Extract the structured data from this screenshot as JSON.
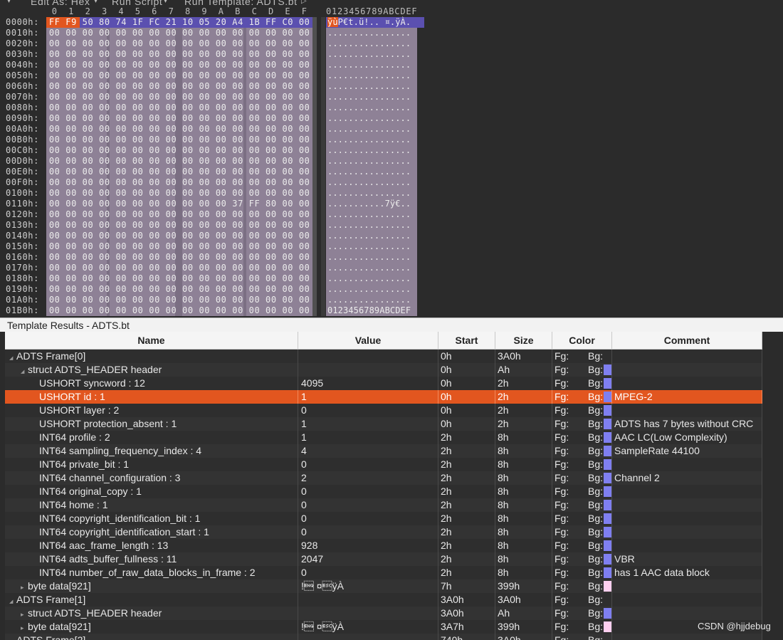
{
  "toolbar": {
    "edit_as": "Edit As: Hex",
    "run_script": "Run Script",
    "run_template": "Run Template: ADTS.bt"
  },
  "hex": {
    "col_headers": [
      "0",
      "1",
      "2",
      "3",
      "4",
      "5",
      "6",
      "7",
      "8",
      "9",
      "A",
      "B",
      "C",
      "D",
      "E",
      "F"
    ],
    "ascii_header": "0123456789ABCDEF",
    "rows": [
      {
        "addr": "0000h:",
        "bytes": [
          "FF",
          "F9",
          "50",
          "80",
          "74",
          "1F",
          "FC",
          "21",
          "10",
          "05",
          "20",
          "A4",
          "1B",
          "FF",
          "C0",
          "00"
        ],
        "ascii": "ÿùP€t.ü!.. ¤.ÿÀ."
      },
      {
        "addr": "0010h:",
        "bytes": [
          "00",
          "00",
          "00",
          "00",
          "00",
          "00",
          "00",
          "00",
          "00",
          "00",
          "00",
          "00",
          "00",
          "00",
          "00",
          "00"
        ],
        "ascii": "................"
      },
      {
        "addr": "0020h:",
        "bytes": [
          "00",
          "00",
          "00",
          "00",
          "00",
          "00",
          "00",
          "00",
          "00",
          "00",
          "00",
          "00",
          "00",
          "00",
          "00",
          "00"
        ],
        "ascii": "................"
      },
      {
        "addr": "0030h:",
        "bytes": [
          "00",
          "00",
          "00",
          "00",
          "00",
          "00",
          "00",
          "00",
          "00",
          "00",
          "00",
          "00",
          "00",
          "00",
          "00",
          "00"
        ],
        "ascii": "................"
      },
      {
        "addr": "0040h:",
        "bytes": [
          "00",
          "00",
          "00",
          "00",
          "00",
          "00",
          "00",
          "00",
          "00",
          "00",
          "00",
          "00",
          "00",
          "00",
          "00",
          "00"
        ],
        "ascii": "................"
      },
      {
        "addr": "0050h:",
        "bytes": [
          "00",
          "00",
          "00",
          "00",
          "00",
          "00",
          "00",
          "00",
          "00",
          "00",
          "00",
          "00",
          "00",
          "00",
          "00",
          "00"
        ],
        "ascii": "................"
      },
      {
        "addr": "0060h:",
        "bytes": [
          "00",
          "00",
          "00",
          "00",
          "00",
          "00",
          "00",
          "00",
          "00",
          "00",
          "00",
          "00",
          "00",
          "00",
          "00",
          "00"
        ],
        "ascii": "................"
      },
      {
        "addr": "0070h:",
        "bytes": [
          "00",
          "00",
          "00",
          "00",
          "00",
          "00",
          "00",
          "00",
          "00",
          "00",
          "00",
          "00",
          "00",
          "00",
          "00",
          "00"
        ],
        "ascii": "................"
      },
      {
        "addr": "0080h:",
        "bytes": [
          "00",
          "00",
          "00",
          "00",
          "00",
          "00",
          "00",
          "00",
          "00",
          "00",
          "00",
          "00",
          "00",
          "00",
          "00",
          "00"
        ],
        "ascii": "................"
      },
      {
        "addr": "0090h:",
        "bytes": [
          "00",
          "00",
          "00",
          "00",
          "00",
          "00",
          "00",
          "00",
          "00",
          "00",
          "00",
          "00",
          "00",
          "00",
          "00",
          "00"
        ],
        "ascii": "................"
      },
      {
        "addr": "00A0h:",
        "bytes": [
          "00",
          "00",
          "00",
          "00",
          "00",
          "00",
          "00",
          "00",
          "00",
          "00",
          "00",
          "00",
          "00",
          "00",
          "00",
          "00"
        ],
        "ascii": "................"
      },
      {
        "addr": "00B0h:",
        "bytes": [
          "00",
          "00",
          "00",
          "00",
          "00",
          "00",
          "00",
          "00",
          "00",
          "00",
          "00",
          "00",
          "00",
          "00",
          "00",
          "00"
        ],
        "ascii": "................"
      },
      {
        "addr": "00C0h:",
        "bytes": [
          "00",
          "00",
          "00",
          "00",
          "00",
          "00",
          "00",
          "00",
          "00",
          "00",
          "00",
          "00",
          "00",
          "00",
          "00",
          "00"
        ],
        "ascii": "................"
      },
      {
        "addr": "00D0h:",
        "bytes": [
          "00",
          "00",
          "00",
          "00",
          "00",
          "00",
          "00",
          "00",
          "00",
          "00",
          "00",
          "00",
          "00",
          "00",
          "00",
          "00"
        ],
        "ascii": "................"
      },
      {
        "addr": "00E0h:",
        "bytes": [
          "00",
          "00",
          "00",
          "00",
          "00",
          "00",
          "00",
          "00",
          "00",
          "00",
          "00",
          "00",
          "00",
          "00",
          "00",
          "00"
        ],
        "ascii": "................"
      },
      {
        "addr": "00F0h:",
        "bytes": [
          "00",
          "00",
          "00",
          "00",
          "00",
          "00",
          "00",
          "00",
          "00",
          "00",
          "00",
          "00",
          "00",
          "00",
          "00",
          "00"
        ],
        "ascii": "................"
      },
      {
        "addr": "0100h:",
        "bytes": [
          "00",
          "00",
          "00",
          "00",
          "00",
          "00",
          "00",
          "00",
          "00",
          "00",
          "00",
          "00",
          "00",
          "00",
          "00",
          "00"
        ],
        "ascii": "................"
      },
      {
        "addr": "0110h:",
        "bytes": [
          "00",
          "00",
          "00",
          "00",
          "00",
          "00",
          "00",
          "00",
          "00",
          "00",
          "00",
          "37",
          "FF",
          "80",
          "00",
          "00"
        ],
        "ascii": "...........7ÿ€.."
      },
      {
        "addr": "0120h:",
        "bytes": [
          "00",
          "00",
          "00",
          "00",
          "00",
          "00",
          "00",
          "00",
          "00",
          "00",
          "00",
          "00",
          "00",
          "00",
          "00",
          "00"
        ],
        "ascii": "................"
      },
      {
        "addr": "0130h:",
        "bytes": [
          "00",
          "00",
          "00",
          "00",
          "00",
          "00",
          "00",
          "00",
          "00",
          "00",
          "00",
          "00",
          "00",
          "00",
          "00",
          "00"
        ],
        "ascii": "................"
      },
      {
        "addr": "0140h:",
        "bytes": [
          "00",
          "00",
          "00",
          "00",
          "00",
          "00",
          "00",
          "00",
          "00",
          "00",
          "00",
          "00",
          "00",
          "00",
          "00",
          "00"
        ],
        "ascii": "................"
      },
      {
        "addr": "0150h:",
        "bytes": [
          "00",
          "00",
          "00",
          "00",
          "00",
          "00",
          "00",
          "00",
          "00",
          "00",
          "00",
          "00",
          "00",
          "00",
          "00",
          "00"
        ],
        "ascii": "................"
      },
      {
        "addr": "0160h:",
        "bytes": [
          "00",
          "00",
          "00",
          "00",
          "00",
          "00",
          "00",
          "00",
          "00",
          "00",
          "00",
          "00",
          "00",
          "00",
          "00",
          "00"
        ],
        "ascii": "................"
      },
      {
        "addr": "0170h:",
        "bytes": [
          "00",
          "00",
          "00",
          "00",
          "00",
          "00",
          "00",
          "00",
          "00",
          "00",
          "00",
          "00",
          "00",
          "00",
          "00",
          "00"
        ],
        "ascii": "................"
      },
      {
        "addr": "0180h:",
        "bytes": [
          "00",
          "00",
          "00",
          "00",
          "00",
          "00",
          "00",
          "00",
          "00",
          "00",
          "00",
          "00",
          "00",
          "00",
          "00",
          "00"
        ],
        "ascii": "................"
      },
      {
        "addr": "0190h:",
        "bytes": [
          "00",
          "00",
          "00",
          "00",
          "00",
          "00",
          "00",
          "00",
          "00",
          "00",
          "00",
          "00",
          "00",
          "00",
          "00",
          "00"
        ],
        "ascii": "................"
      },
      {
        "addr": "01A0h:",
        "bytes": [
          "00",
          "00",
          "00",
          "00",
          "00",
          "00",
          "00",
          "00",
          "00",
          "00",
          "00",
          "00",
          "00",
          "00",
          "00",
          "00"
        ],
        "ascii": "................"
      },
      {
        "addr": "01B0h:",
        "bytes": [
          "00",
          "00",
          "00",
          "00",
          "00",
          "00",
          "00",
          "00",
          "00",
          "00",
          "00",
          "00",
          "00",
          "00",
          "00",
          "00"
        ],
        "ascii": "0123456789ABCDEF"
      }
    ],
    "selected_bytes": 2
  },
  "template": {
    "title": "Template Results - ADTS.bt",
    "headers": [
      "Name",
      "Value",
      "Start",
      "Size",
      "Color",
      "Comment"
    ],
    "fg_label": "Fg:",
    "bg_label": "Bg:",
    "rows": [
      {
        "level": 0,
        "expand": "open",
        "name": "ADTS Frame[0]",
        "value": "",
        "start": "0h",
        "size": "3A0h",
        "swatch": "",
        "comment": ""
      },
      {
        "level": 1,
        "expand": "open",
        "name": "struct ADTS_HEADER header",
        "value": "",
        "start": "0h",
        "size": "Ah",
        "swatch": "#7f7ff0",
        "comment": ""
      },
      {
        "level": 2,
        "expand": "",
        "name": "USHORT syncword : 12",
        "value": "4095",
        "start": "0h",
        "size": "2h",
        "swatch": "#7f7ff0",
        "comment": ""
      },
      {
        "level": 2,
        "expand": "",
        "name": "USHORT id : 1",
        "value": "1",
        "start": "0h",
        "size": "2h",
        "swatch": "#7f7ff0",
        "comment": "MPEG-2",
        "selected": true
      },
      {
        "level": 2,
        "expand": "",
        "name": "USHORT layer : 2",
        "value": "0",
        "start": "0h",
        "size": "2h",
        "swatch": "#7f7ff0",
        "comment": ""
      },
      {
        "level": 2,
        "expand": "",
        "name": "USHORT protection_absent : 1",
        "value": "1",
        "start": "0h",
        "size": "2h",
        "swatch": "#7f7ff0",
        "comment": "ADTS has 7 bytes without CRC"
      },
      {
        "level": 2,
        "expand": "",
        "name": "INT64 profile : 2",
        "value": "1",
        "start": "2h",
        "size": "8h",
        "swatch": "#7f7ff0",
        "comment": "AAC LC(Low Complexity)"
      },
      {
        "level": 2,
        "expand": "",
        "name": "INT64 sampling_frequency_index : 4",
        "value": "4",
        "start": "2h",
        "size": "8h",
        "swatch": "#7f7ff0",
        "comment": "SampleRate 44100"
      },
      {
        "level": 2,
        "expand": "",
        "name": "INT64 private_bit : 1",
        "value": "0",
        "start": "2h",
        "size": "8h",
        "swatch": "#7f7ff0",
        "comment": ""
      },
      {
        "level": 2,
        "expand": "",
        "name": "INT64 channel_configuration : 3",
        "value": "2",
        "start": "2h",
        "size": "8h",
        "swatch": "#7f7ff0",
        "comment": "Channel 2"
      },
      {
        "level": 2,
        "expand": "",
        "name": "INT64 original_copy : 1",
        "value": "0",
        "start": "2h",
        "size": "8h",
        "swatch": "#7f7ff0",
        "comment": ""
      },
      {
        "level": 2,
        "expand": "",
        "name": "INT64 home : 1",
        "value": "0",
        "start": "2h",
        "size": "8h",
        "swatch": "#7f7ff0",
        "comment": ""
      },
      {
        "level": 2,
        "expand": "",
        "name": "INT64 copyright_identification_bit : 1",
        "value": "0",
        "start": "2h",
        "size": "8h",
        "swatch": "#7f7ff0",
        "comment": ""
      },
      {
        "level": 2,
        "expand": "",
        "name": "INT64 copyright_identification_start : 1",
        "value": "0",
        "start": "2h",
        "size": "8h",
        "swatch": "#7f7ff0",
        "comment": ""
      },
      {
        "level": 2,
        "expand": "",
        "name": "INT64 aac_frame_length : 13",
        "value": "928",
        "start": "2h",
        "size": "8h",
        "swatch": "#7f7ff0",
        "comment": ""
      },
      {
        "level": 2,
        "expand": "",
        "name": "INT64 adts_buffer_fullness : 11",
        "value": "2047",
        "start": "2h",
        "size": "8h",
        "swatch": "#7f7ff0",
        "comment": "VBR"
      },
      {
        "level": 2,
        "expand": "",
        "name": "INT64 number_of_raw_data_blocks_in_frame : 2",
        "value": "0",
        "start": "2h",
        "size": "8h",
        "swatch": "#7f7ff0",
        "comment": "has 1 AAC data block"
      },
      {
        "level": 1,
        "expand": "closed",
        "name": "byte data[921]",
        "value": "!\u0005 ¤\u001bÿÀ",
        "start": "7h",
        "size": "399h",
        "swatch": "#ffd0f0",
        "comment": ""
      },
      {
        "level": 0,
        "expand": "open",
        "name": "ADTS Frame[1]",
        "value": "",
        "start": "3A0h",
        "size": "3A0h",
        "swatch": "",
        "comment": ""
      },
      {
        "level": 1,
        "expand": "closed",
        "name": "struct ADTS_HEADER header",
        "value": "",
        "start": "3A0h",
        "size": "Ah",
        "swatch": "#7f7ff0",
        "comment": ""
      },
      {
        "level": 1,
        "expand": "closed",
        "name": "byte data[921]",
        "value": "!\u0005 ¤\u001bÿÀ",
        "start": "3A7h",
        "size": "399h",
        "swatch": "#ffd0f0",
        "comment": ""
      },
      {
        "level": 0,
        "expand": "open",
        "name": "ADTS Frame[2]",
        "value": "",
        "start": "740h",
        "size": "3A0h",
        "swatch": "",
        "comment": ""
      }
    ]
  },
  "colors": {
    "selection": "#e2561f",
    "struct_bg": "#7f7ff0",
    "data_bg": "#ffd0f0",
    "hex_bg": "#8e8196"
  },
  "credit": "CSDN @hjjdebug"
}
